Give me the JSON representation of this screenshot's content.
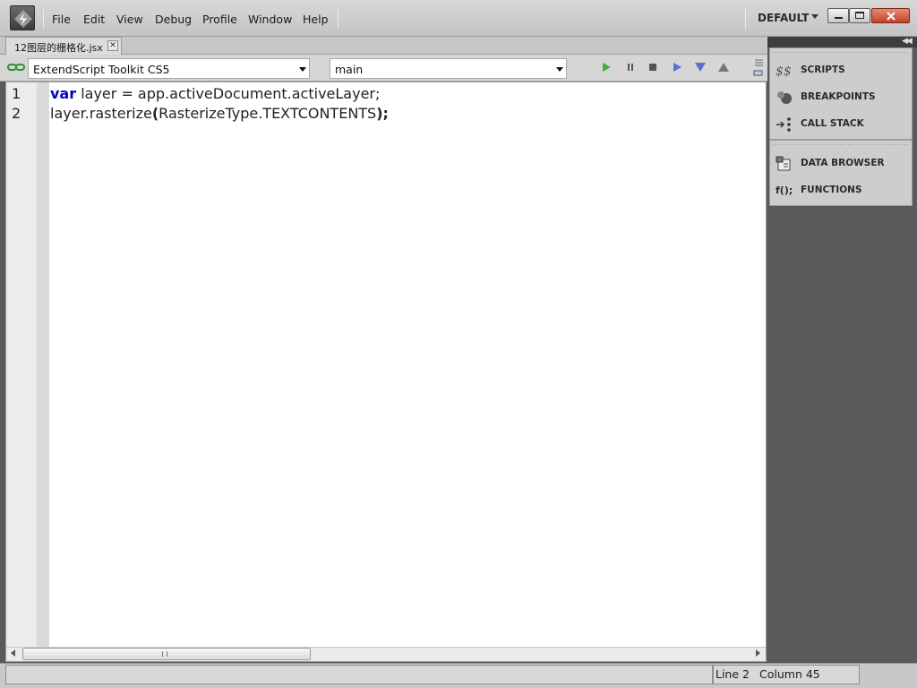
{
  "menu": {
    "items": [
      "File",
      "Edit",
      "View",
      "Debug",
      "Profile",
      "Window",
      "Help"
    ]
  },
  "workspace": {
    "label": "DEFAULT"
  },
  "tabs": [
    {
      "label": "12图层的栅格化.jsx"
    }
  ],
  "toolbar": {
    "target_app": "ExtendScript Toolkit CS5",
    "target_engine": "main"
  },
  "editor": {
    "line_numbers": [
      "1",
      "2"
    ],
    "line1": {
      "kw": "var",
      "rest": " layer = app.activeDocument.activeLayer;"
    },
    "line2": {
      "a": "layer.rasterize",
      "b": "(",
      "c": "RasterizeType.TEXTCONTENTS",
      "d": ");"
    }
  },
  "status": {
    "line": "Line 2",
    "column": "Column 45"
  },
  "panels": {
    "group1": [
      "SCRIPTS",
      "BREAKPOINTS",
      "CALL STACK"
    ],
    "group2": [
      "DATA BROWSER",
      "FUNCTIONS"
    ],
    "functions_icon": "f();"
  },
  "icons": {
    "logo": "estk-logo-icon",
    "link": "link-icon",
    "run": "run-icon",
    "pause": "pause-icon",
    "stop": "stop-icon",
    "step_over": "step-over-icon",
    "step_into": "step-into-icon",
    "step_out": "step-out-icon",
    "panel_menu": "panel-menu-icon"
  },
  "colors": {
    "keyword": "#0000c8",
    "run": "#3fae3f",
    "step": "#5a6fd0"
  }
}
